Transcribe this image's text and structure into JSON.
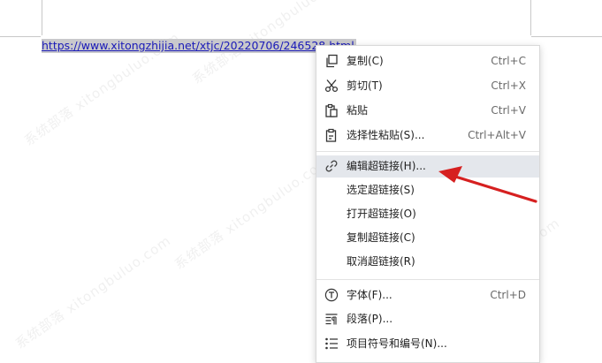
{
  "document": {
    "hyperlink_text": "https://www.xitongzhijia.net/xtjc/20220706/246528.html"
  },
  "context_menu": {
    "items": [
      {
        "icon": "copy-icon",
        "label": "复制(C)",
        "shortcut": "Ctrl+C"
      },
      {
        "icon": "cut-icon",
        "label": "剪切(T)",
        "shortcut": "Ctrl+X"
      },
      {
        "icon": "paste-icon",
        "label": "粘贴",
        "shortcut": "Ctrl+V"
      },
      {
        "icon": "paste-special-icon",
        "label": "选择性粘贴(S)...",
        "shortcut": "Ctrl+Alt+V"
      },
      {
        "icon": "link-icon",
        "label": "编辑超链接(H)...",
        "shortcut": ""
      },
      {
        "icon": "",
        "label": "选定超链接(S)",
        "shortcut": ""
      },
      {
        "icon": "",
        "label": "打开超链接(O)",
        "shortcut": ""
      },
      {
        "icon": "",
        "label": "复制超链接(C)",
        "shortcut": ""
      },
      {
        "icon": "",
        "label": "取消超链接(R)",
        "shortcut": ""
      },
      {
        "icon": "font-icon",
        "label": "字体(F)...",
        "shortcut": "Ctrl+D"
      },
      {
        "icon": "paragraph-icon",
        "label": "段落(P)...",
        "shortcut": ""
      },
      {
        "icon": "bullet-list-icon",
        "label": "项目符号和编号(N)...",
        "shortcut": ""
      }
    ],
    "highlighted_item": "编辑超链接(H)..."
  },
  "annotation": {
    "arrow_color": "#d62020"
  },
  "watermark": {
    "text": "系统部落 xitongbuluo.com"
  }
}
